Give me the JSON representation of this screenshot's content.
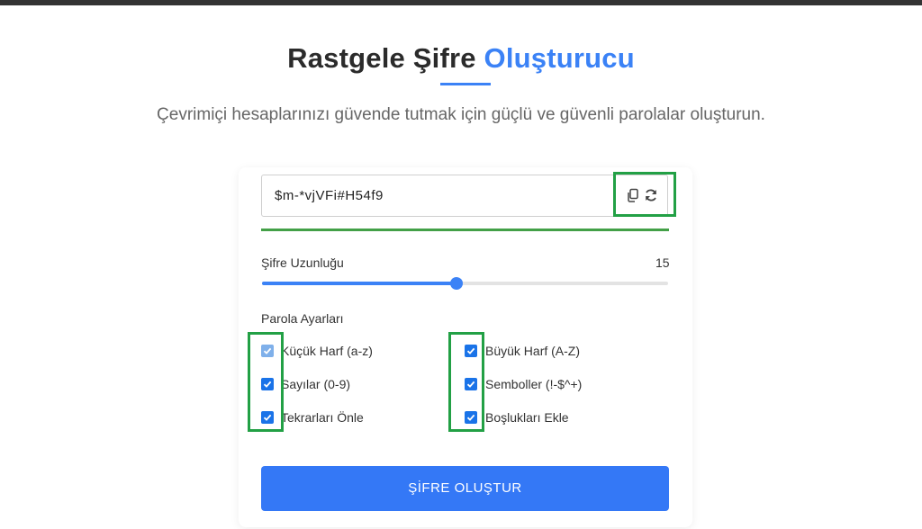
{
  "header": {
    "title_main": "Rastgele Şifre",
    "title_accent": "Oluşturucu",
    "subtitle": "Çevrimiçi hesaplarınızı güvende tutmak için güçlü ve güvenli parolalar oluşturun."
  },
  "generator": {
    "password": "$m-*vjVFi#H54f9",
    "copy_icon": "copy-icon",
    "refresh_icon": "refresh-icon",
    "strength_color": "#43a047"
  },
  "length": {
    "label": "Şifre Uzunluğu",
    "value": "15",
    "slider_fraction": 0.48
  },
  "options": {
    "label": "Parola Ayarları",
    "items": [
      {
        "label": "Küçük Harf (a-z)",
        "checked": true
      },
      {
        "label": "Büyük Harf (A-Z)",
        "checked": true
      },
      {
        "label": "Sayılar (0-9)",
        "checked": true
      },
      {
        "label": "Semboller (!-$^+)",
        "checked": true
      },
      {
        "label": "Tekrarları Önle",
        "checked": true
      },
      {
        "label": "Boşlukları Ekle",
        "checked": true
      }
    ]
  },
  "actions": {
    "generate_label": "ŞİFRE OLUŞTUR"
  },
  "colors": {
    "accent": "#3b82f6",
    "highlight": "#22a045",
    "button": "#3478f6"
  }
}
